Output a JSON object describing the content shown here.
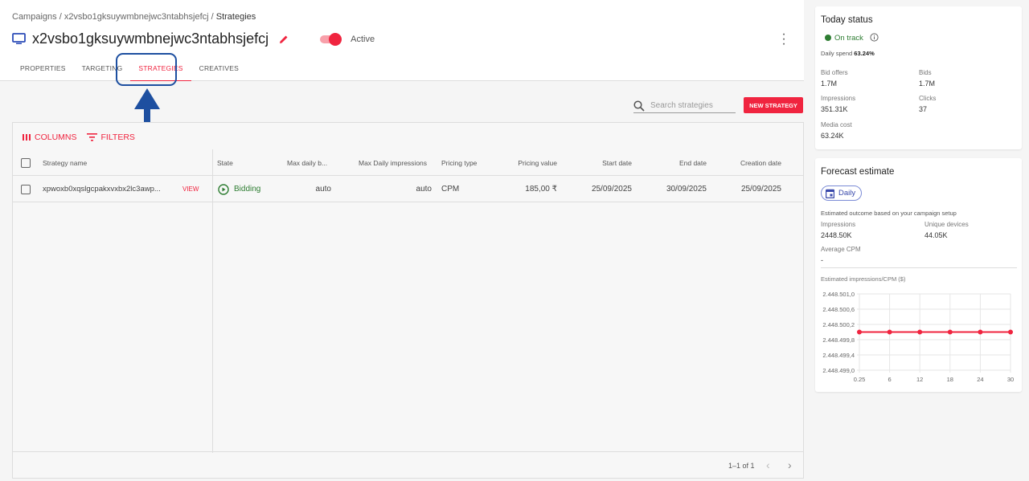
{
  "breadcrumb": [
    "Campaigns",
    "x2vsbo1gksuywmbnejwc3ntabhsjefcj",
    "Strategies"
  ],
  "header": {
    "title": "x2vsbo1gksuywmbnejwc3ntabhsjefcj",
    "status": "Active",
    "status_on": true
  },
  "tabs": [
    {
      "label": "PROPERTIES"
    },
    {
      "label": "TARGETING"
    },
    {
      "label": "STRATEGIES",
      "selected": true
    },
    {
      "label": "CREATIVES"
    }
  ],
  "toolbar": {
    "search_placeholder": "Search strategies",
    "new_strategy": "NEW STRATEGY",
    "columns": "COLUMNS",
    "filters": "FILTERS"
  },
  "table": {
    "headers": [
      "Strategy name",
      "State",
      "Max daily b...",
      "Max Daily impressions",
      "Pricing type",
      "Pricing value",
      "Start date",
      "End date",
      "Creation date"
    ],
    "rows": [
      {
        "name": "xpwoxb0xqslgcpakxvxbx2lc3awp...",
        "view": "VIEW",
        "state": "Bidding",
        "max_daily_budget": "auto",
        "max_daily_impressions": "auto",
        "pricing_type": "CPM",
        "pricing_value": "185,00 ₹",
        "start": "25/09/2025",
        "end": "30/09/2025",
        "created": "25/09/2025"
      }
    ],
    "pagination": "1–1 of 1"
  },
  "today": {
    "title": "Today status",
    "status": "On track",
    "daily_spend_label": "Daily spend",
    "daily_spend": "63.24%",
    "bid_offers_label": "Bid offers",
    "bid_offers": "1.7M",
    "bids_label": "Bids",
    "bids": "1.7M",
    "impressions_label": "Impressions",
    "impressions": "351.31K",
    "clicks_label": "Clicks",
    "clicks": "37",
    "media_cost_label": "Media cost",
    "media_cost": "63.24K"
  },
  "forecast": {
    "title": "Forecast estimate",
    "period": "Daily",
    "desc": "Estimated outcome based on your campaign setup",
    "impressions_label": "Impressions",
    "impressions": "2448.50K",
    "devices_label": "Unique devices",
    "devices": "44.05K",
    "cpm_label": "Average CPM",
    "cpm": "-"
  },
  "colors": {
    "accent": "#f0243f",
    "ok": "#2e7d32",
    "highlight": "#1d4fa0"
  },
  "chart_data": {
    "type": "line",
    "title": "Estimated impressions/CPM ($)",
    "x": [
      "0.25",
      "6",
      "12",
      "18",
      "24",
      "30"
    ],
    "series": [
      {
        "values": [
          2448500,
          2448500,
          2448500,
          2448500,
          2448500,
          2448500
        ]
      }
    ],
    "yticks": [
      "2.448.501,0",
      "2.448.500,6",
      "2.448.500,2",
      "2.448.499,8",
      "2.448.499,4",
      "2.448.499,0"
    ],
    "ylim": [
      2448499.0,
      2448501.0
    ],
    "grid": true,
    "color": "#f0243f"
  }
}
